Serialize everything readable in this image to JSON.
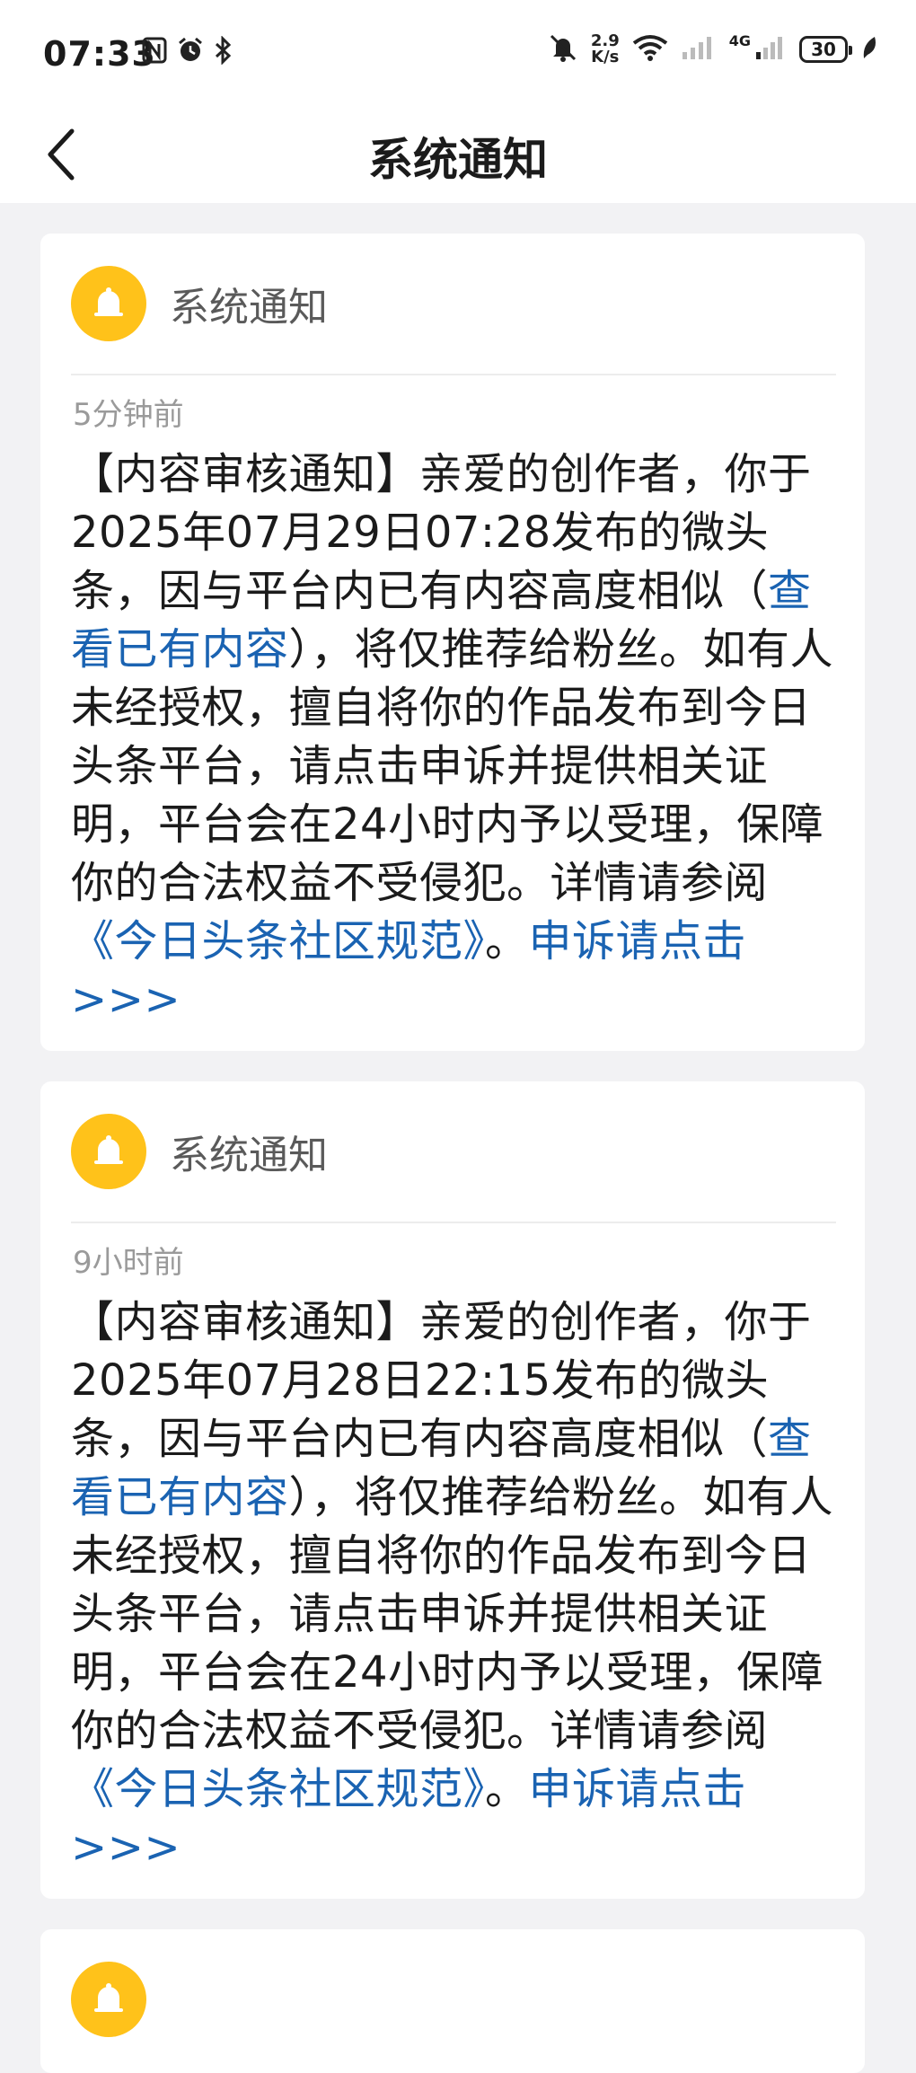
{
  "status_bar": {
    "time": "07:33",
    "speed_value": "2.9",
    "speed_unit": "K/s",
    "network": "4G",
    "battery": "30"
  },
  "nav": {
    "title": "系统通知"
  },
  "notifications": [
    {
      "sender": "系统通知",
      "time": "5分钟前",
      "body_1": "【内容审核通知】亲爱的创作者，你于2025年07月29日07:28发布的微头条，因与平台内已有内容高度相似（",
      "view_link": "查看已有内容",
      "body_2": "），将仅推荐给粉丝。如有人未经授权，擅自将你的作品发布到今日头条平台，请点击申诉并提供相关证明，平台会在24小时内予以受理，保障你的合法权益不受侵犯。详情请参阅",
      "rules_link": "《今日头条社区规范》",
      "body_3": "。",
      "appeal_link": "申诉请点击>>>"
    },
    {
      "sender": "系统通知",
      "time": "9小时前",
      "body_1": "【内容审核通知】亲爱的创作者，你于2025年07月28日22:15发布的微头条，因与平台内已有内容高度相似（",
      "view_link": "查看已有内容",
      "body_2": "），将仅推荐给粉丝。如有人未经授权，擅自将你的作品发布到今日头条平台，请点击申诉并提供相关证明，平台会在24小时内予以受理，保障你的合法权益不受侵犯。详情请参阅",
      "rules_link": "《今日头条社区规范》",
      "body_3": "。",
      "appeal_link": "申诉请点击>>>"
    }
  ],
  "colors": {
    "link": "#1a63b2",
    "bell": "#ffc21a",
    "background": "#f2f2f4"
  },
  "icons": [
    "nfc-icon",
    "alarm-icon",
    "bluetooth-icon",
    "mute-icon",
    "wifi-icon",
    "signal-icon",
    "leaf-icon",
    "back-arrow-icon",
    "bell-icon"
  ]
}
